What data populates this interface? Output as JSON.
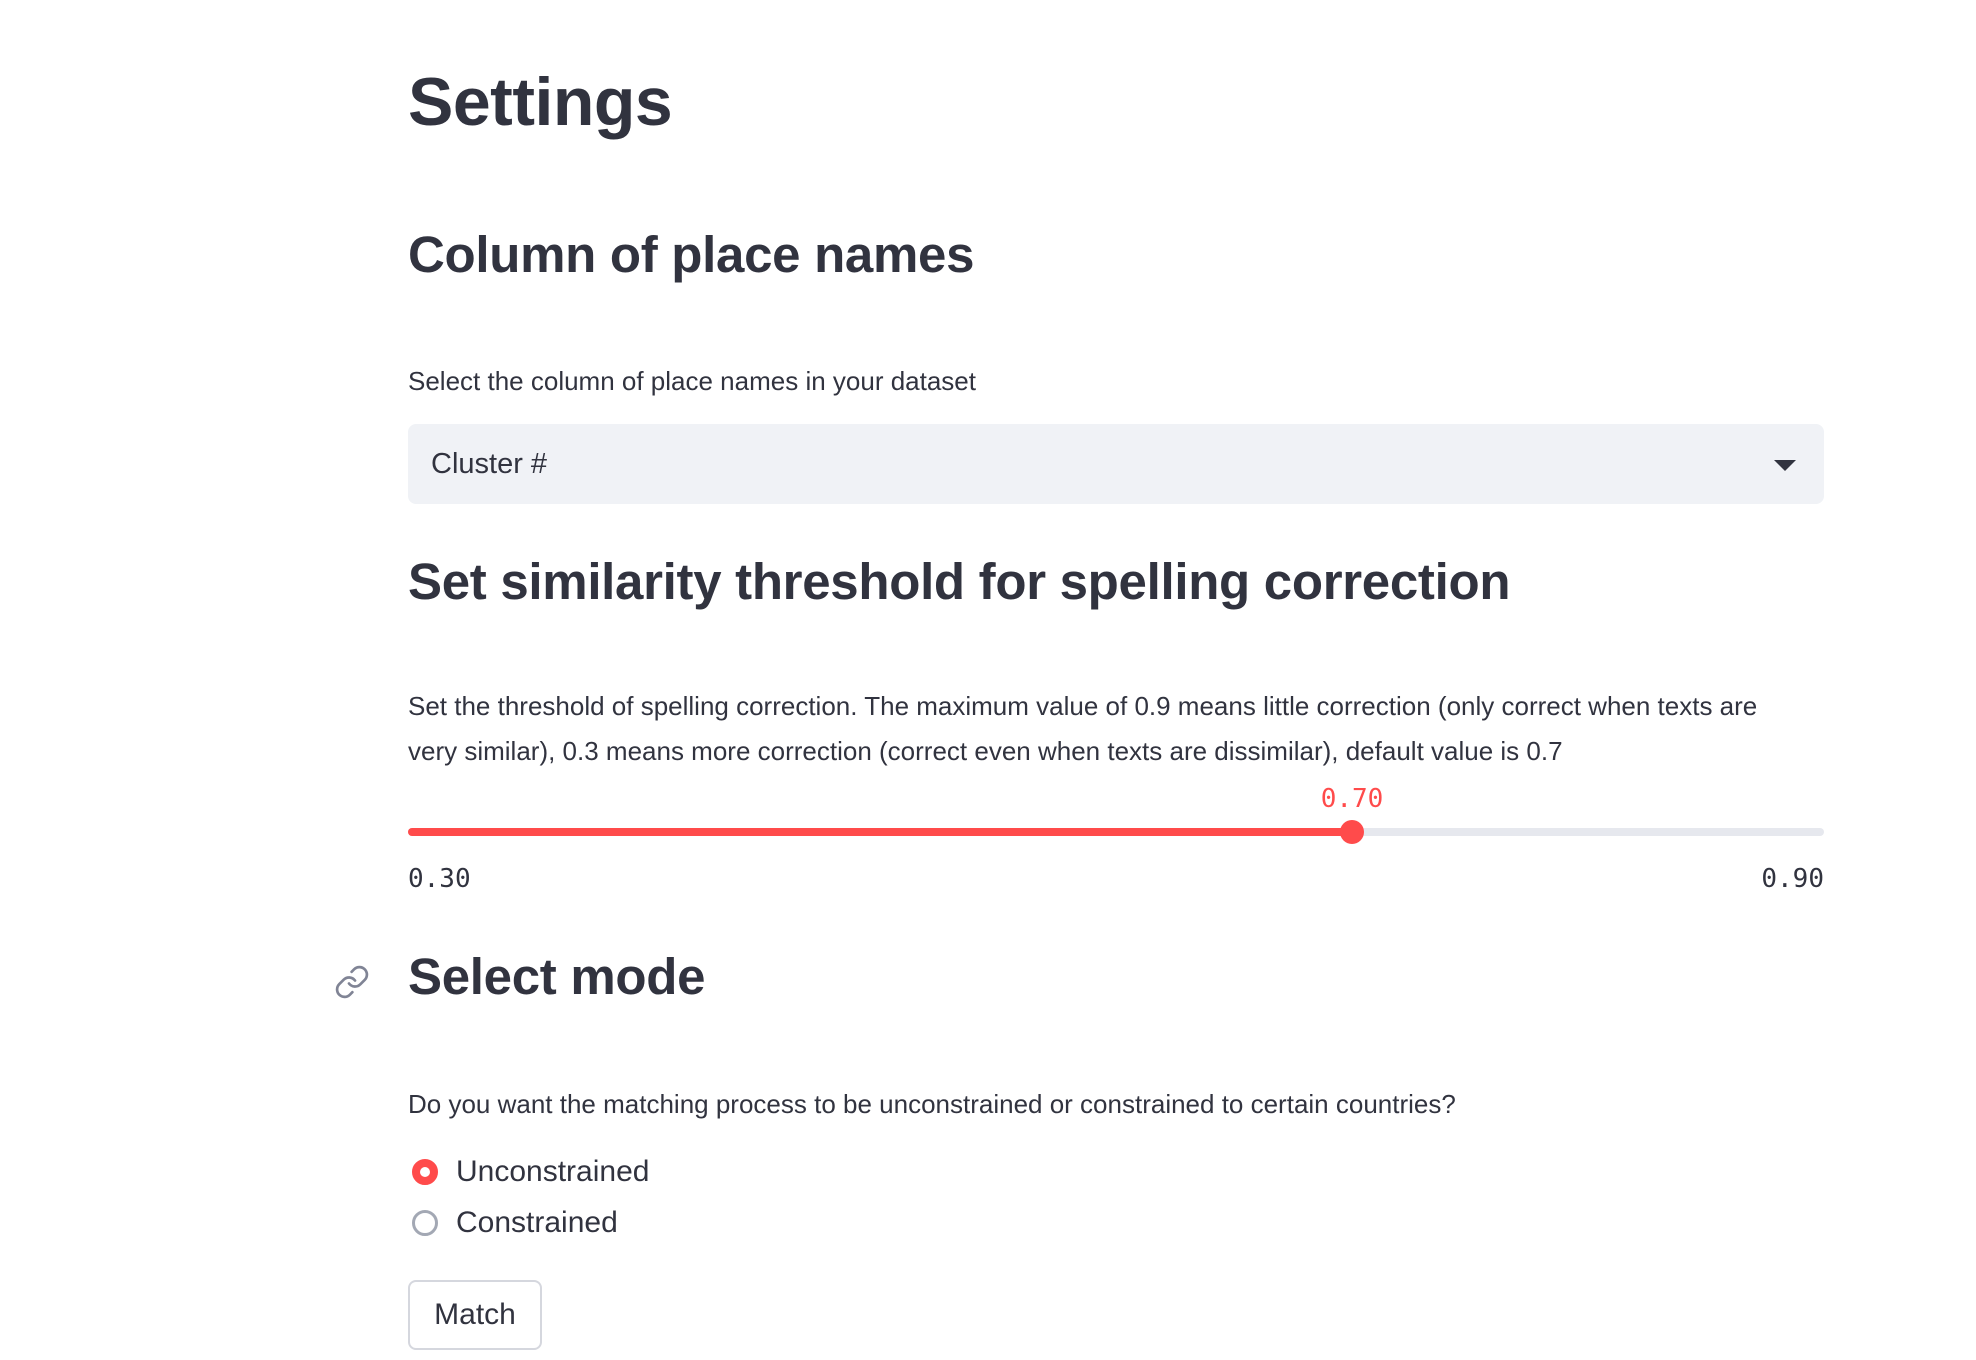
{
  "page": {
    "title": "Settings"
  },
  "column_section": {
    "heading": "Column of place names",
    "label": "Select the column of place names in your dataset",
    "selected_value": "Cluster #"
  },
  "threshold_section": {
    "heading": "Set similarity threshold for spelling correction",
    "label_line1": "Set the threshold of spelling correction. The maximum value of 0.9 means little correction (only correct when texts are",
    "label_line2": "very similar), 0.3 means more correction (correct even when texts are dissimilar), default value is 0.7",
    "slider": {
      "value": 0.7,
      "value_label": "0.70",
      "min": 0.3,
      "min_label": "0.30",
      "max": 0.9,
      "max_label": "0.90"
    }
  },
  "mode_section": {
    "heading": "Select mode",
    "label": "Do you want the matching process to be unconstrained or constrained to certain countries?",
    "options": [
      {
        "label": "Unconstrained",
        "checked": true
      },
      {
        "label": "Constrained",
        "checked": false
      }
    ],
    "button_label": "Match"
  },
  "colors": {
    "accent": "#ff4b4b",
    "text": "#31333f",
    "select_background": "#f0f2f6",
    "track": "#e6e8ee"
  },
  "icons": {
    "heading_anchor": "link-icon",
    "select_arrow": "caret-down-icon"
  }
}
